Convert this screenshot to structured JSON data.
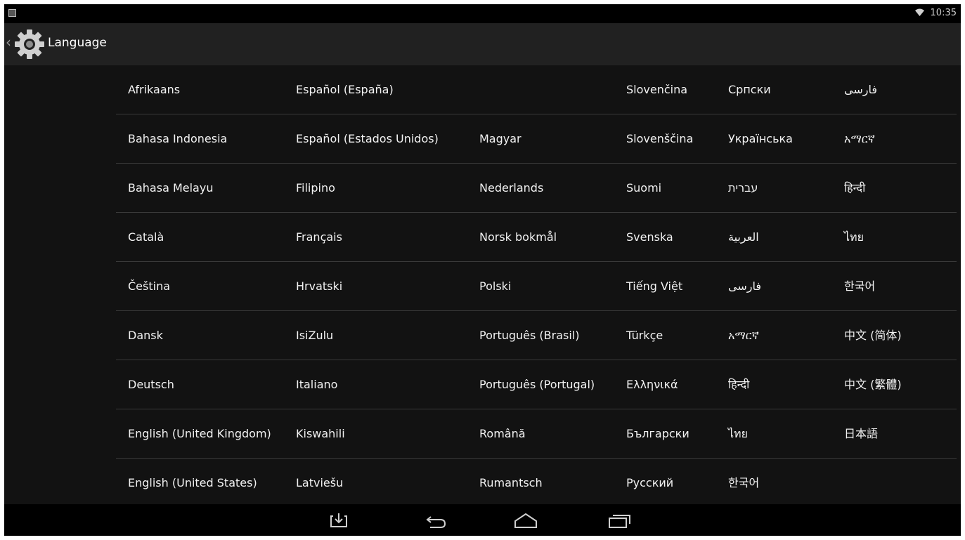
{
  "status_bar": {
    "notification_icon": "notification-icon",
    "wifi_icon": "wifi-icon",
    "clock": "10:35"
  },
  "action_bar": {
    "back_icon": "back-caret-icon",
    "app_icon": "gear-icon",
    "title": "Language"
  },
  "languages": [
    [
      "Afrikaans",
      "Español (España)",
      "",
      "Slovenčina",
      "Српски",
      "فارسی"
    ],
    [
      "Bahasa Indonesia",
      "Español (Estados Unidos)",
      "Magyar",
      "Slovenščina",
      "Українська",
      "አማርኛ"
    ],
    [
      "Bahasa Melayu",
      "Filipino",
      "Nederlands",
      "Suomi",
      "עברית",
      "हिन्दी"
    ],
    [
      "Català",
      "Français",
      "Norsk bokmål",
      "Svenska",
      "العربية",
      "ไทย"
    ],
    [
      "Čeština",
      "Hrvatski",
      "Polski",
      "Tiếng Việt",
      "فارسی",
      "한국어"
    ],
    [
      "Dansk",
      "IsiZulu",
      "Português (Brasil)",
      "Türkçe",
      "አማርኛ",
      "中文 (简体)"
    ],
    [
      "Deutsch",
      "Italiano",
      "Português (Portugal)",
      "Ελληνικά",
      "हिन्दी",
      "中文 (繁體)"
    ],
    [
      "English (United Kingdom)",
      "Kiswahili",
      "Română",
      "Български",
      "ไทย",
      "日本語"
    ],
    [
      "English (United States)",
      "Latviešu",
      "Rumantsch",
      "Русский",
      "한국어",
      ""
    ]
  ],
  "nav_bar": {
    "buttons": [
      "download-icon",
      "back-icon",
      "home-icon",
      "recent-apps-icon"
    ]
  },
  "colors": {
    "background": "#121212",
    "action_bar": "#212121",
    "status_bar": "#000000",
    "text": "#f2f2f2",
    "divider": "#3a3a3a"
  }
}
